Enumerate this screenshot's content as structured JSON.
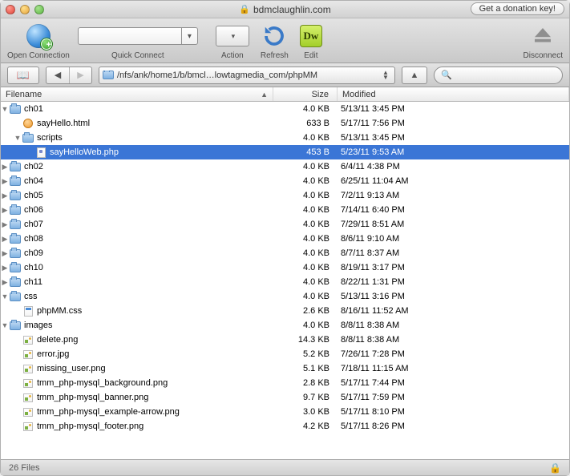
{
  "window": {
    "title": "bdmclaughlin.com"
  },
  "topButtons": {
    "donate": "Get a donation key!"
  },
  "toolbar": {
    "openConnection": "Open Connection",
    "quickConnect": "Quick Connect",
    "action": "Action",
    "refresh": "Refresh",
    "edit": "Edit",
    "disconnect": "Disconnect"
  },
  "path": {
    "display": "/nfs/ank/home1/b/bmcl…lowtagmedia_com/phpMM"
  },
  "columns": {
    "filename": "Filename",
    "size": "Size",
    "modified": "Modified"
  },
  "search": {
    "placeholder": ""
  },
  "status": {
    "count": "26 Files"
  },
  "rows": [
    {
      "depth": 1,
      "expand": "down",
      "icon": "folder",
      "name": "ch01",
      "size": "4.0 KB",
      "mod": "5/13/11 3:45 PM",
      "sel": false
    },
    {
      "depth": 2,
      "expand": "none",
      "icon": "html",
      "name": "sayHello.html",
      "size": "633 B",
      "mod": "5/17/11 7:56 PM",
      "sel": false
    },
    {
      "depth": 2,
      "expand": "down",
      "icon": "folder",
      "name": "scripts",
      "size": "4.0 KB",
      "mod": "5/13/11 3:45 PM",
      "sel": false
    },
    {
      "depth": 3,
      "expand": "none",
      "icon": "php",
      "name": "sayHelloWeb.php",
      "size": "453 B",
      "mod": "5/23/11 9:53 AM",
      "sel": true
    },
    {
      "depth": 1,
      "expand": "right",
      "icon": "folder",
      "name": "ch02",
      "size": "4.0 KB",
      "mod": "6/4/11 4:38 PM",
      "sel": false
    },
    {
      "depth": 1,
      "expand": "right",
      "icon": "folder",
      "name": "ch04",
      "size": "4.0 KB",
      "mod": "6/25/11 11:04 AM",
      "sel": false
    },
    {
      "depth": 1,
      "expand": "right",
      "icon": "folder",
      "name": "ch05",
      "size": "4.0 KB",
      "mod": "7/2/11 9:13 AM",
      "sel": false
    },
    {
      "depth": 1,
      "expand": "right",
      "icon": "folder",
      "name": "ch06",
      "size": "4.0 KB",
      "mod": "7/14/11 6:40 PM",
      "sel": false
    },
    {
      "depth": 1,
      "expand": "right",
      "icon": "folder",
      "name": "ch07",
      "size": "4.0 KB",
      "mod": "7/29/11 8:51 AM",
      "sel": false
    },
    {
      "depth": 1,
      "expand": "right",
      "icon": "folder",
      "name": "ch08",
      "size": "4.0 KB",
      "mod": "8/6/11 9:10 AM",
      "sel": false
    },
    {
      "depth": 1,
      "expand": "right",
      "icon": "folder",
      "name": "ch09",
      "size": "4.0 KB",
      "mod": "8/7/11 8:37 AM",
      "sel": false
    },
    {
      "depth": 1,
      "expand": "right",
      "icon": "folder",
      "name": "ch10",
      "size": "4.0 KB",
      "mod": "8/19/11 3:17 PM",
      "sel": false
    },
    {
      "depth": 1,
      "expand": "right",
      "icon": "folder",
      "name": "ch11",
      "size": "4.0 KB",
      "mod": "8/22/11 1:31 PM",
      "sel": false
    },
    {
      "depth": 1,
      "expand": "down",
      "icon": "folder",
      "name": "css",
      "size": "4.0 KB",
      "mod": "5/13/11 3:16 PM",
      "sel": false
    },
    {
      "depth": 2,
      "expand": "none",
      "icon": "css",
      "name": "phpMM.css",
      "size": "2.6 KB",
      "mod": "8/16/11 11:52 AM",
      "sel": false
    },
    {
      "depth": 1,
      "expand": "down",
      "icon": "folder",
      "name": "images",
      "size": "4.0 KB",
      "mod": "8/8/11 8:38 AM",
      "sel": false
    },
    {
      "depth": 2,
      "expand": "none",
      "icon": "img",
      "name": "delete.png",
      "size": "14.3 KB",
      "mod": "8/8/11 8:38 AM",
      "sel": false
    },
    {
      "depth": 2,
      "expand": "none",
      "icon": "img",
      "name": "error.jpg",
      "size": "5.2 KB",
      "mod": "7/26/11 7:28 PM",
      "sel": false
    },
    {
      "depth": 2,
      "expand": "none",
      "icon": "img",
      "name": "missing_user.png",
      "size": "5.1 KB",
      "mod": "7/18/11 11:15 AM",
      "sel": false
    },
    {
      "depth": 2,
      "expand": "none",
      "icon": "img",
      "name": "tmm_php-mysql_background.png",
      "size": "2.8 KB",
      "mod": "5/17/11 7:44 PM",
      "sel": false
    },
    {
      "depth": 2,
      "expand": "none",
      "icon": "img",
      "name": "tmm_php-mysql_banner.png",
      "size": "9.7 KB",
      "mod": "5/17/11 7:59 PM",
      "sel": false
    },
    {
      "depth": 2,
      "expand": "none",
      "icon": "img",
      "name": "tmm_php-mysql_example-arrow.png",
      "size": "3.0 KB",
      "mod": "5/17/11 8:10 PM",
      "sel": false
    },
    {
      "depth": 2,
      "expand": "none",
      "icon": "img",
      "name": "tmm_php-mysql_footer.png",
      "size": "4.2 KB",
      "mod": "5/17/11 8:26 PM",
      "sel": false
    }
  ]
}
